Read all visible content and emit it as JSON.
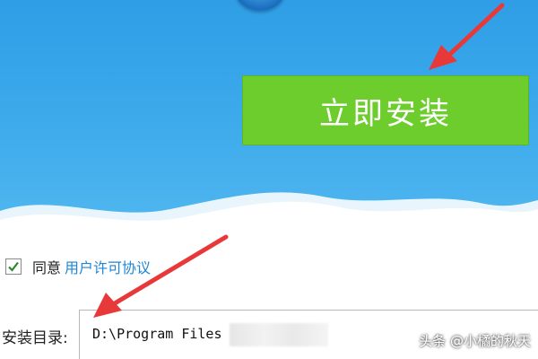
{
  "installer": {
    "install_button_label": "立即安装",
    "agree_label": "同意",
    "license_link_label": "用户许可协议",
    "agree_checked": true,
    "install_dir_label": "安装目录:",
    "install_dir_value": "D:\\Program Files"
  },
  "watermark": {
    "text": "头条 @小橘的秋天"
  },
  "colors": {
    "hero_blue": "#3aa8ea",
    "install_button_green": "#6ccd2d",
    "link_blue": "#1f86d6",
    "annotation_arrow_red": "#e8393a"
  },
  "icons": {
    "checkbox": "checkmark-icon",
    "logo": "logo-icon",
    "annotation": "arrow-icon"
  }
}
